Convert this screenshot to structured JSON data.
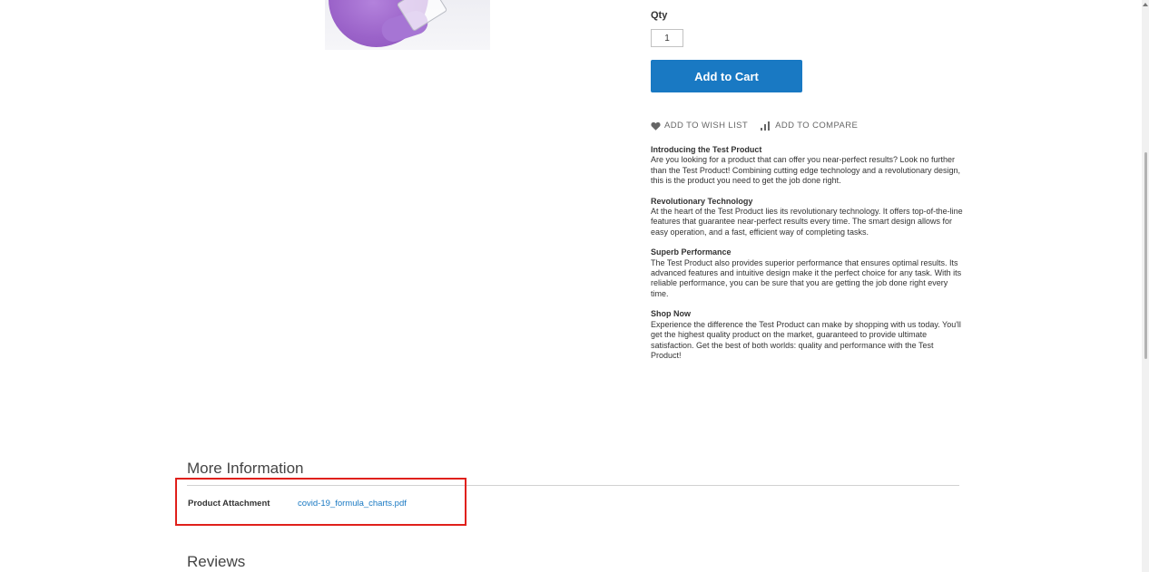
{
  "product": {
    "qty_label": "Qty",
    "qty_value": "1",
    "add_to_cart_label": "Add to Cart",
    "wishlist_label": "ADD TO WISH LIST",
    "compare_label": "ADD TO COMPARE"
  },
  "description": {
    "sections": [
      {
        "heading": "Introducing the Test Product",
        "body": "Are you looking for a product that can offer you near-perfect results? Look no further than the Test Product! Combining cutting edge technology and a revolutionary design, this is the product you need to get the job done right."
      },
      {
        "heading": "Revolutionary Technology",
        "body": "At the heart of the Test Product lies its revolutionary technology. It offers top-of-the-line features that guarantee near-perfect results every time. The smart design allows for easy operation, and a fast, efficient way of completing tasks."
      },
      {
        "heading": "Superb Performance",
        "body": "The Test Product also provides superior performance that ensures optimal results. Its advanced features and intuitive design make it the perfect choice for any task. With its reliable performance, you can be sure that you are getting the job done right every time."
      },
      {
        "heading": "Shop Now",
        "body": "Experience the difference the Test Product can make by shopping with us today. You'll get the highest quality product on the market, guaranteed to provide ultimate satisfaction. Get the best of both worlds: quality and performance with the Test Product!"
      }
    ]
  },
  "more_info": {
    "title": "More Information",
    "attachment_label": "Product Attachment",
    "attachment_file": "covid-19_formula_charts.pdf"
  },
  "reviews": {
    "title": "Reviews"
  },
  "colors": {
    "accent": "#1979c3",
    "highlight": "#e0201b"
  },
  "icons": {
    "wishlist": "heart-icon",
    "compare": "compare-icon"
  }
}
